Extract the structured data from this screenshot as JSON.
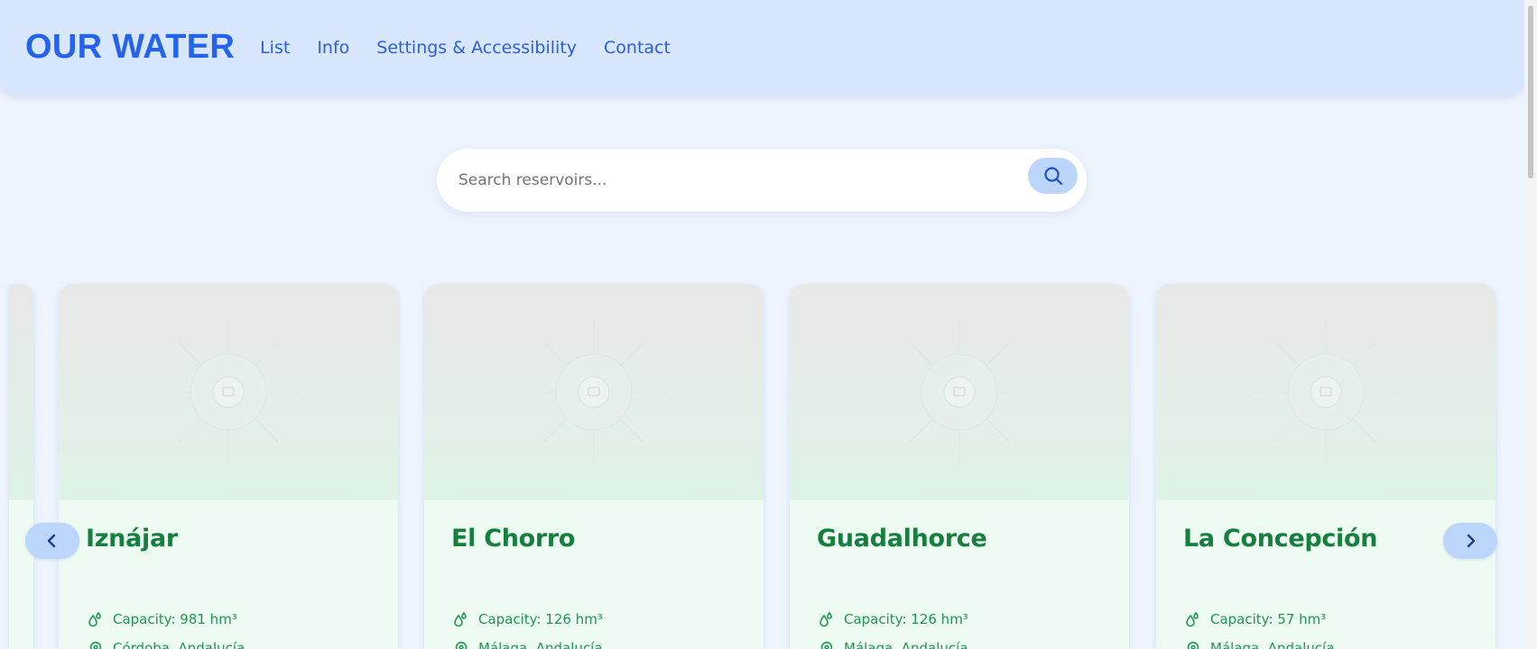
{
  "header": {
    "logo": "OUR WATER",
    "nav": [
      "List",
      "Info",
      "Settings & Accessibility",
      "Contact"
    ]
  },
  "search": {
    "placeholder": "Search reservoirs...",
    "button_icon": "search-icon"
  },
  "carousel": {
    "prev_icon": "chevron-left-icon",
    "next_icon": "chevron-right-icon",
    "cards": [
      {
        "name": "Iznájar",
        "capacity": "Capacity: 981 hm³",
        "location": "Córdoba, Andalucía"
      },
      {
        "name": "El Chorro",
        "capacity": "Capacity: 126 hm³",
        "location": "Málaga, Andalucía"
      },
      {
        "name": "Guadalhorce",
        "capacity": "Capacity: 126 hm³",
        "location": "Málaga, Andalucía"
      },
      {
        "name": "La Concepción",
        "capacity": "Capacity: 57 hm³",
        "location": "Málaga, Andalucía"
      }
    ]
  },
  "colors": {
    "accent": "#2563eb",
    "header_bg": "#d8e7fd",
    "card_title": "#15803d"
  }
}
